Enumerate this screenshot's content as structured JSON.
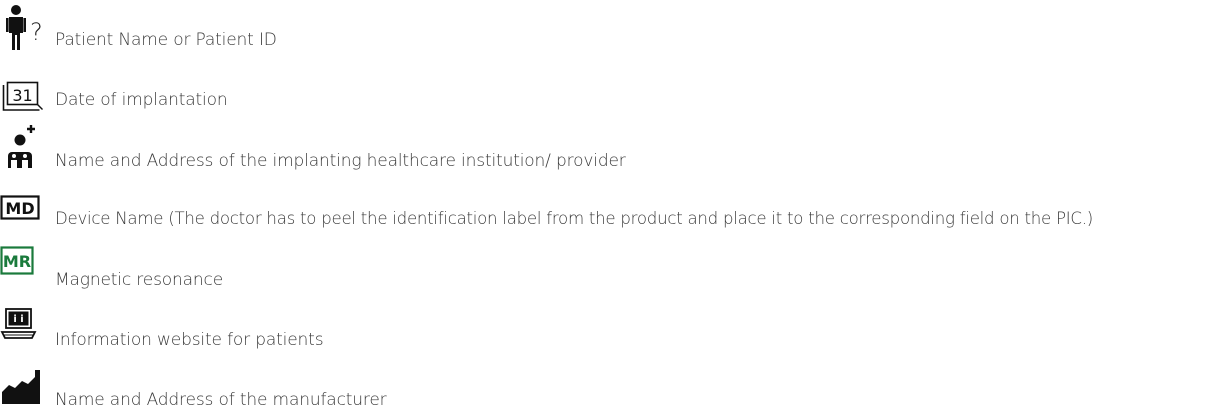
{
  "colors": {
    "icon": "#111111",
    "mr_green": "#1a7a3c",
    "text": "#3a3a3a"
  },
  "symbols": [
    {
      "icon": "patient-icon",
      "icon_text": "?",
      "label": "Patient Name or Patient ID"
    },
    {
      "icon": "calendar-icon",
      "icon_text": "31",
      "label": "Date of implantation"
    },
    {
      "icon": "healthcare-provider-icon",
      "label": "Name and Address of the implanting healthcare institution/ provider"
    },
    {
      "icon": "medical-device-icon",
      "icon_text": "MD",
      "label": "Device Name (The doctor has to peel the identification label from the product and place it to the corresponding field on the PIC.)"
    },
    {
      "icon": "mr-safe-icon",
      "icon_text": "MR",
      "label": "Magnetic resonance"
    },
    {
      "icon": "info-website-icon",
      "label": "Information website for patients"
    },
    {
      "icon": "manufacturer-icon",
      "label": "Name and Address of the manufacturer"
    }
  ]
}
